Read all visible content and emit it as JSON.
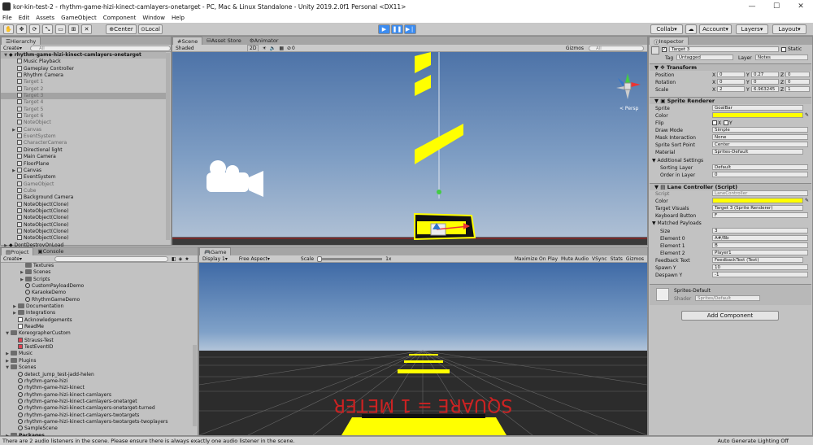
{
  "window": {
    "title": "kor-kin-test-2 - rhythm-game-hizi-kinect-camlayers-onetarget - PC, Mac & Linux Standalone - Unity 2019.2.0f1 Personal <DX11>",
    "minimize": "—",
    "maximize": "☐",
    "close": "✕"
  },
  "menu": [
    "File",
    "Edit",
    "Assets",
    "GameObject",
    "Component",
    "Window",
    "Help"
  ],
  "toolbar": {
    "pivot_label": "Center",
    "space_label": "Local",
    "collab_label": "Collab",
    "account_label": "Account",
    "layers_label": "Layers",
    "layout_label": "Layout"
  },
  "hierarchy": {
    "tab": "Hierarchy",
    "create": "Create",
    "search_placeholder": "All",
    "scene_name": "rhythm-game-hizi-kinect-camlayers-onetarget",
    "items": [
      {
        "label": "Music Playback",
        "dim": false
      },
      {
        "label": "Gameplay Controller",
        "dim": false
      },
      {
        "label": "Rhythm Camera",
        "dim": false
      },
      {
        "label": "Target 1",
        "dim": true
      },
      {
        "label": "Target 2",
        "dim": true
      },
      {
        "label": "Target 3",
        "dim": true,
        "selected": true
      },
      {
        "label": "Target 4",
        "dim": true
      },
      {
        "label": "Target 5",
        "dim": true
      },
      {
        "label": "Target 6",
        "dim": true
      },
      {
        "label": "NoteObject",
        "dim": true
      },
      {
        "label": "Canvas",
        "dim": true,
        "arrow": true
      },
      {
        "label": "EventSystem",
        "dim": true
      },
      {
        "label": "CharacterCamera",
        "dim": true
      },
      {
        "label": "Directional light",
        "dim": false
      },
      {
        "label": "Main Camera",
        "dim": false
      },
      {
        "label": "FloorPlane",
        "dim": false
      },
      {
        "label": "Canvas",
        "dim": false,
        "arrow": true
      },
      {
        "label": "EventSystem",
        "dim": false
      },
      {
        "label": "GameObject",
        "dim": true
      },
      {
        "label": "Cube",
        "dim": true
      },
      {
        "label": "Background Camera",
        "dim": false
      },
      {
        "label": "NoteObject(Clone)",
        "dim": false
      },
      {
        "label": "NoteObject(Clone)",
        "dim": false
      },
      {
        "label": "NoteObject(Clone)",
        "dim": false
      },
      {
        "label": "NoteObject(Clone)",
        "dim": false
      },
      {
        "label": "NoteObject(Clone)",
        "dim": false
      },
      {
        "label": "NoteObject(Clone)",
        "dim": false
      }
    ],
    "dontdestroy": "DontDestroyOnLoad"
  },
  "project": {
    "tab_project": "Project",
    "tab_console": "Console",
    "create": "Create",
    "items": [
      {
        "label": "Textures",
        "indent": 2,
        "type": "folder"
      },
      {
        "label": "Scenes",
        "indent": 2,
        "type": "folder",
        "arrow": true
      },
      {
        "label": "Scripts",
        "indent": 2,
        "type": "folder",
        "arrow": true
      },
      {
        "label": "CustomPayloadDemo",
        "indent": 2,
        "type": "scene"
      },
      {
        "label": "KaraokeDemo",
        "indent": 2,
        "type": "scene"
      },
      {
        "label": "RhythmGameDemo",
        "indent": 2,
        "type": "scene"
      },
      {
        "label": "Documentation",
        "indent": 1,
        "type": "folder",
        "arrow": true
      },
      {
        "label": "Integrations",
        "indent": 1,
        "type": "folder",
        "arrow": true
      },
      {
        "label": "Acknowledgements",
        "indent": 1,
        "type": "file"
      },
      {
        "label": "ReadMe",
        "indent": 1,
        "type": "file"
      },
      {
        "label": "KoreographerCustom",
        "indent": 0,
        "type": "folder",
        "arrow": true,
        "open": true
      },
      {
        "label": "Strauss-Test",
        "indent": 1,
        "type": "koreo"
      },
      {
        "label": "TestEventID",
        "indent": 1,
        "type": "koreo"
      },
      {
        "label": "Music",
        "indent": 0,
        "type": "folder",
        "arrow": true
      },
      {
        "label": "Plugins",
        "indent": 0,
        "type": "folder",
        "arrow": true
      },
      {
        "label": "Scenes",
        "indent": 0,
        "type": "folder",
        "arrow": true,
        "open": true
      },
      {
        "label": "detect_jump_test-jadd-helen",
        "indent": 1,
        "type": "scene"
      },
      {
        "label": "rhythm-game-hizi",
        "indent": 1,
        "type": "scene"
      },
      {
        "label": "rhythm-game-hizi-kinect",
        "indent": 1,
        "type": "scene"
      },
      {
        "label": "rhythm-game-hizi-kinect-camlayers",
        "indent": 1,
        "type": "scene"
      },
      {
        "label": "rhythm-game-hizi-kinect-camlayers-onetarget",
        "indent": 1,
        "type": "scene"
      },
      {
        "label": "rhythm-game-hizi-kinect-camlayers-onetarget-turned",
        "indent": 1,
        "type": "scene"
      },
      {
        "label": "rhythm-game-hizi-kinect-camlayers-twotargets",
        "indent": 1,
        "type": "scene"
      },
      {
        "label": "rhythm-game-hizi-kinect-camlayers-twotargets-twoplayers",
        "indent": 1,
        "type": "scene"
      },
      {
        "label": "SampleScene",
        "indent": 1,
        "type": "scene"
      },
      {
        "label": "Packages",
        "indent": 0,
        "type": "folder",
        "arrow": true,
        "bold": true
      }
    ]
  },
  "scene": {
    "tabs": [
      "Scene",
      "Asset Store",
      "Animator"
    ],
    "shading": "Shaded",
    "mode2d": "2D",
    "gizmos": "Gizmos",
    "search": "All",
    "persp": "< Persp",
    "counter": "0"
  },
  "game": {
    "tab": "Game",
    "display": "Display 1",
    "aspect": "Free Aspect",
    "scale_label": "Scale",
    "scale_value": "1x",
    "maximize": "Maximize On Play",
    "mute": "Mute Audio",
    "vsync": "VSync",
    "stats": "Stats",
    "gizmos": "Gizmos",
    "overlay_text": "SQUARE = 1 METER"
  },
  "inspector": {
    "tab": "Inspector",
    "name": "Target 3",
    "static": "Static",
    "tag_label": "Tag",
    "tag_value": "Untagged",
    "layer_label": "Layer",
    "layer_value": "Notes",
    "transform": {
      "title": "Transform",
      "position_label": "Position",
      "position": [
        "0",
        "0.27",
        "0"
      ],
      "rotation_label": "Rotation",
      "rotation": [
        "0",
        "0",
        "0"
      ],
      "scale_label": "Scale",
      "scale": [
        "2",
        "6.963245",
        "1"
      ],
      "axes": [
        "X",
        "Y",
        "Z"
      ]
    },
    "sprite": {
      "title": "Sprite Renderer",
      "sprite_label": "Sprite",
      "sprite_value": "GoalBar",
      "color_label": "Color",
      "color": "#ffff00",
      "flip_label": "Flip",
      "flip_x": "X",
      "flip_y": "Y",
      "draw_label": "Draw Mode",
      "draw_value": "Simple",
      "mask_label": "Mask Interaction",
      "mask_value": "None",
      "sort_label": "Sprite Sort Point",
      "sort_value": "Center",
      "material_label": "Material",
      "material_value": "Sprites-Default",
      "additional": "Additional Settings",
      "sorting_layer_label": "Sorting Layer",
      "sorting_layer_value": "Default",
      "order_label": "Order in Layer",
      "order_value": "0"
    },
    "lane": {
      "title": "Lane Controller (Script)",
      "script_label": "Script",
      "script_value": "LaneController",
      "color_label": "Color",
      "color": "#ffff00",
      "target_label": "Target Visuals",
      "target_value": "Target 3 (Sprite Renderer)",
      "key_label": "Keyboard Button",
      "key_value": "F",
      "payloads_label": "Matched Payloads",
      "size_label": "Size",
      "size_value": "3",
      "e0_label": "Element 0",
      "e0_value": "A#/Bb",
      "e1_label": "Element 1",
      "e1_value": "B",
      "e2_label": "Element 2",
      "e2_value": "Player1",
      "feedback_label": "Feedback Text",
      "feedback_value": "FeedbackText (Text)",
      "spawn_label": "Spawn Y",
      "spawn_value": "10",
      "despawn_label": "Despawn Y",
      "despawn_value": "-1"
    },
    "material": {
      "name": "Sprites-Default",
      "shader_label": "Shader",
      "shader_value": "Sprites/Default"
    },
    "add_component": "Add Component"
  },
  "status": {
    "message": "There are 2 audio listeners in the scene. Please ensure there is always exactly one audio listener in the scene.",
    "lighting": "Auto Generate Lighting Off"
  }
}
